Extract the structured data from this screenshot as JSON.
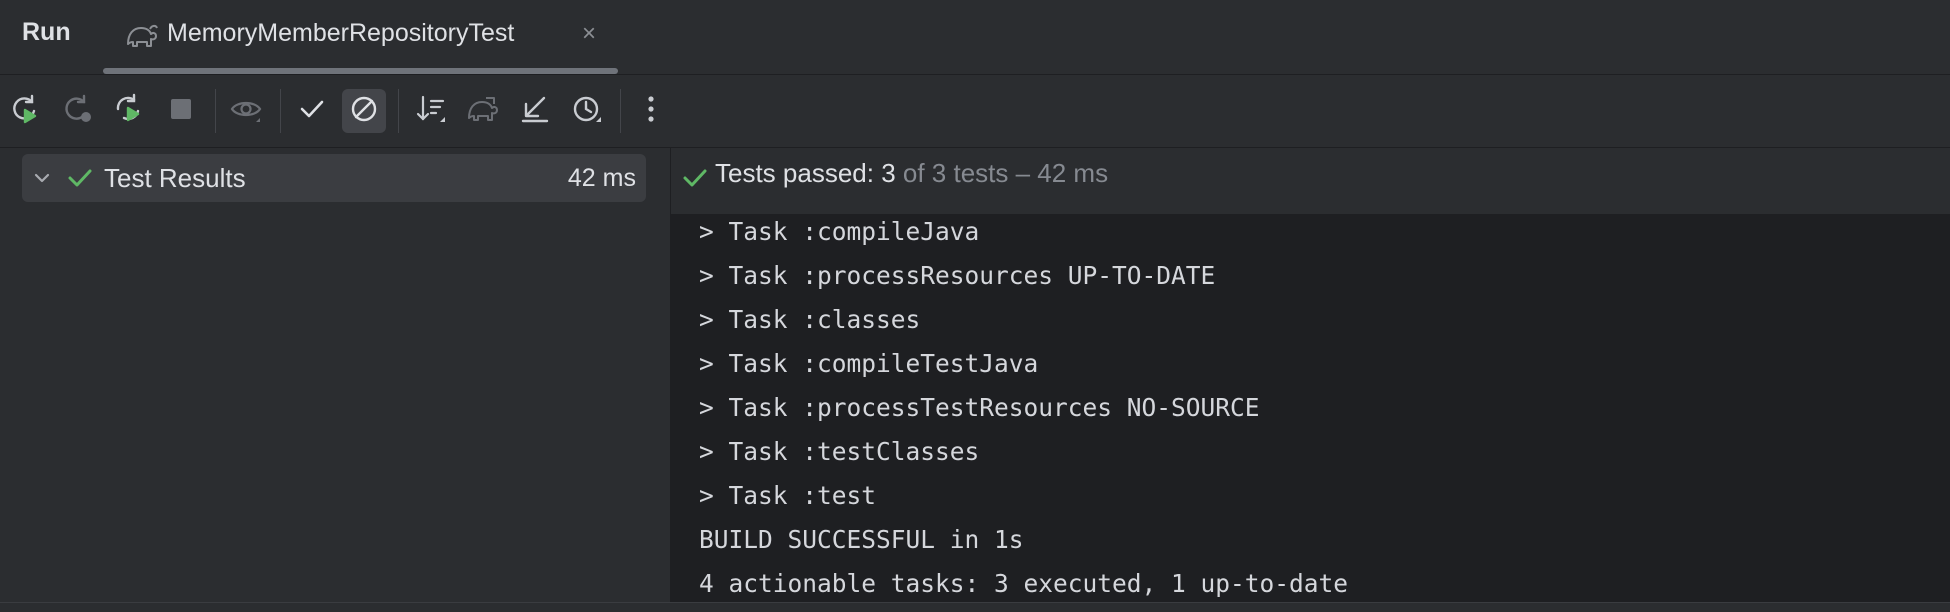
{
  "header": {
    "run_label": "Run",
    "tab": {
      "label": "MemoryMemberRepositoryTest",
      "icon": "gradle-elephant-icon",
      "close_glyph": "×"
    }
  },
  "toolbar": {
    "buttons": [
      {
        "name": "rerun-icon",
        "state": "enabled"
      },
      {
        "name": "rerun-failed-icon",
        "state": "disabled"
      },
      {
        "name": "rerun-automatically-icon",
        "state": "enabled"
      },
      {
        "name": "stop-icon",
        "state": "disabled"
      },
      {
        "name": "eye-icon",
        "state": "disabled"
      },
      {
        "name": "show-passed-icon",
        "state": "enabled"
      },
      {
        "name": "show-ignored-icon",
        "state": "active"
      },
      {
        "name": "sort-icon",
        "state": "enabled"
      },
      {
        "name": "gradle-icon",
        "state": "disabled"
      },
      {
        "name": "collapse-all-icon",
        "state": "enabled"
      },
      {
        "name": "history-icon",
        "state": "enabled"
      },
      {
        "name": "more-icon",
        "state": "enabled"
      }
    ]
  },
  "tree": {
    "root": {
      "label": "Test Results",
      "time": "42 ms",
      "status": "passed"
    }
  },
  "status": {
    "main": "Tests passed: 3",
    "sub": " of 3 tests – 42 ms"
  },
  "console": {
    "lines": [
      "> Task :compileJava",
      "> Task :processResources UP-TO-DATE",
      "> Task :classes",
      "> Task :compileTestJava",
      "> Task :processTestResources NO-SOURCE",
      "> Task :testClasses",
      "> Task :test",
      "BUILD SUCCESSFUL in 1s",
      "4 actionable tasks: 3 executed, 1 up-to-date"
    ]
  },
  "colors": {
    "background": "#2b2d30",
    "console_background": "#1e1f22",
    "success_green": "#5fb865",
    "text": "#dfe1e5",
    "muted_text": "#868a91"
  }
}
